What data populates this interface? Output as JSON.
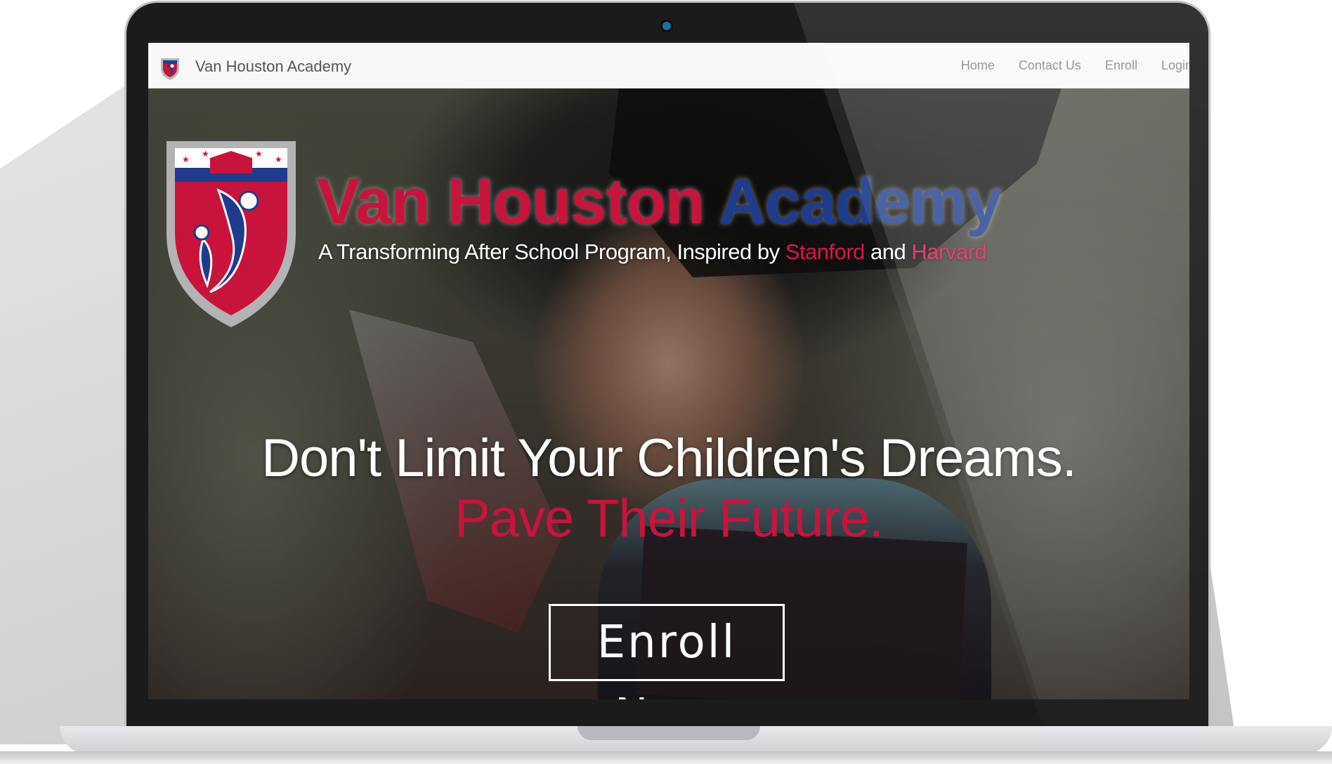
{
  "navbar": {
    "brand": "Van Houston Academy",
    "links": [
      "Home",
      "Contact Us",
      "Enroll",
      "Login"
    ]
  },
  "hero": {
    "title_part1": "Van Houston",
    "title_part2": "Academy",
    "tagline_prefix": "A Transforming After School Program, Inspired by",
    "tagline_stanford": "Stanford",
    "tagline_and": "and",
    "tagline_harvard": "Harvard",
    "headline": "Don't Limit Your Children's Dreams.",
    "subheadline": "Pave Their Future.",
    "cta_label": "Enroll Now"
  },
  "colors": {
    "brand_red": "#c8143c",
    "brand_blue": "#1f3c8c",
    "navbar_bg": "#f8f8f8"
  },
  "icons": {
    "brand_logo": "academy-shield-icon",
    "hero_logo": "academy-shield-icon"
  }
}
